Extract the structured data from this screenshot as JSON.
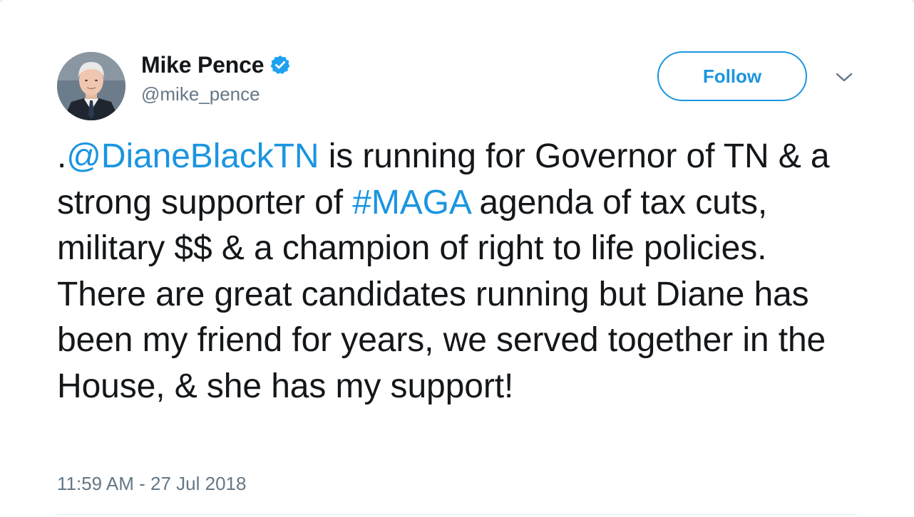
{
  "user": {
    "display_name": "Mike Pence",
    "handle": "@mike_pence",
    "verified": true,
    "avatar": "profile-photo"
  },
  "actions": {
    "follow_label": "Follow",
    "menu_icon": "chevron-down-icon"
  },
  "tweet": {
    "segments": [
      {
        "text": ".",
        "link": false
      },
      {
        "text": "@DianeBlackTN",
        "link": true
      },
      {
        "text": " is running for Governor of TN & a strong supporter of ",
        "link": false
      },
      {
        "text": "#MAGA",
        "link": true
      },
      {
        "text": " agenda of tax cuts, military $$ & a champion of right to life policies. There are great candidates running but Diane has been my friend for years, we served together in the House, & she has my support!",
        "link": false
      }
    ],
    "timestamp": "11:59 AM - 27 Jul 2018"
  },
  "colors": {
    "accent": "#1b95e0",
    "text": "#14171a",
    "secondary": "#657786",
    "verified_badge": "#1da1f2"
  }
}
